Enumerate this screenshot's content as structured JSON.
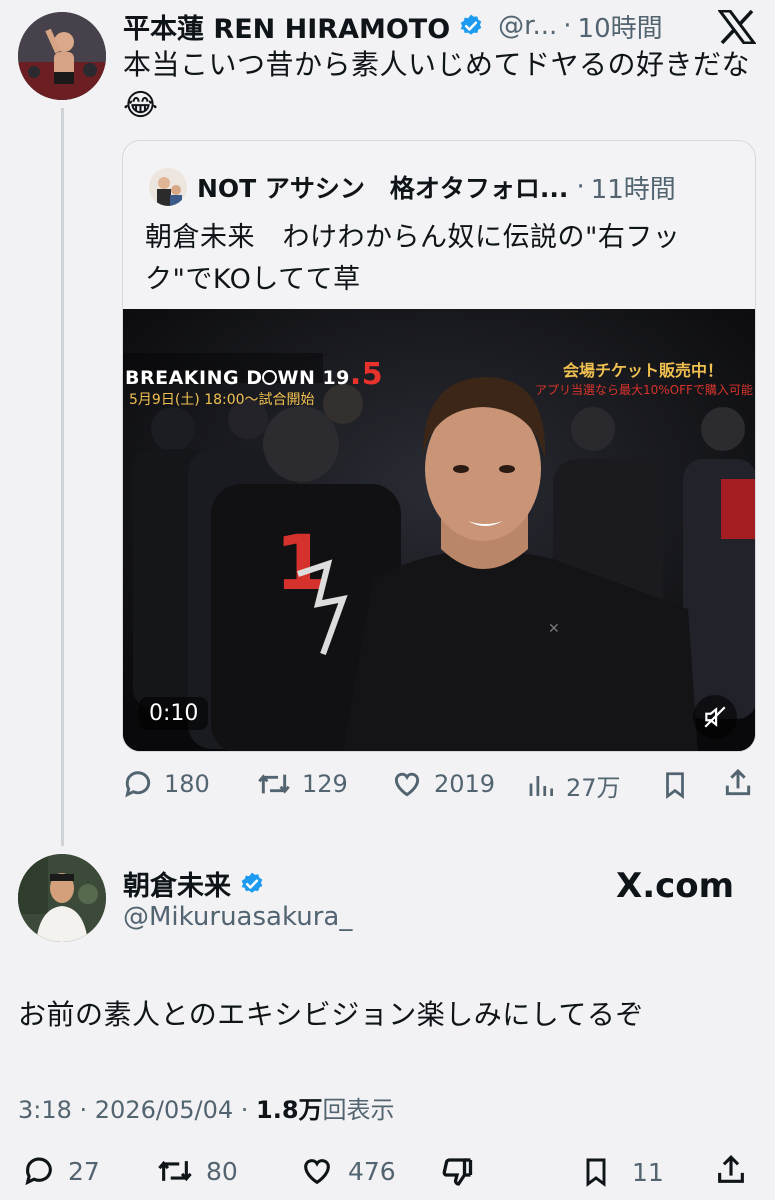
{
  "top_tweet": {
    "display_name": "平本蓮 REN HIRAMOTO",
    "handle": "@r...",
    "separator": "·",
    "time": "10時間",
    "text": "本当こいつ昔から素人いじめてドヤるの好きだな",
    "emoji": "😂",
    "x_logo": "X"
  },
  "quoted_tweet": {
    "display_name": "NOT アサシン　格オタフォロ...",
    "separator": "·",
    "time": "11時間",
    "text_line1": "朝倉未来　わけわからん奴に伝説の\"右フッ",
    "text_line2": "ク\"でKOしてて草",
    "video": {
      "overlay_title": "BREAKING D",
      "overlay_title2": "WN 19",
      "overlay_num": ".5",
      "overlay_date": "5月9日(土) 18:00〜試合開始",
      "overlay_ticket": "会場チケット販売中！",
      "overlay_ticket_sub": "アプリ当選なら最大10%OFFで購入可能！",
      "shirt_number": "1",
      "duration": "0:10",
      "mute_icon": "speaker-muted-icon"
    }
  },
  "top_actions": {
    "reply_count": "180",
    "retweet_count": "129",
    "like_count": "2019",
    "views_count": "27万",
    "bookmark_icon": "bookmark-icon",
    "share_icon": "share-icon"
  },
  "main_tweet": {
    "display_name": "朝倉未来",
    "handle": "@Mikuruasakura_",
    "xcom_label": "X.com",
    "text": "お前の素人とのエキシビジョン楽しみにしてるぞ",
    "timestamp": "3:18 · 2026/05/04 · ",
    "views_value": "1.8万",
    "views_label": "回表示"
  },
  "bottom_actions": {
    "reply_count": "27",
    "retweet_count": "80",
    "like_count": "476",
    "bookmark_count": "11"
  },
  "colors": {
    "verified": "#1d9bf0",
    "text": "#0f1419",
    "muted": "#536471",
    "background": "#f2f2f4",
    "accent_red": "#e8322b"
  }
}
